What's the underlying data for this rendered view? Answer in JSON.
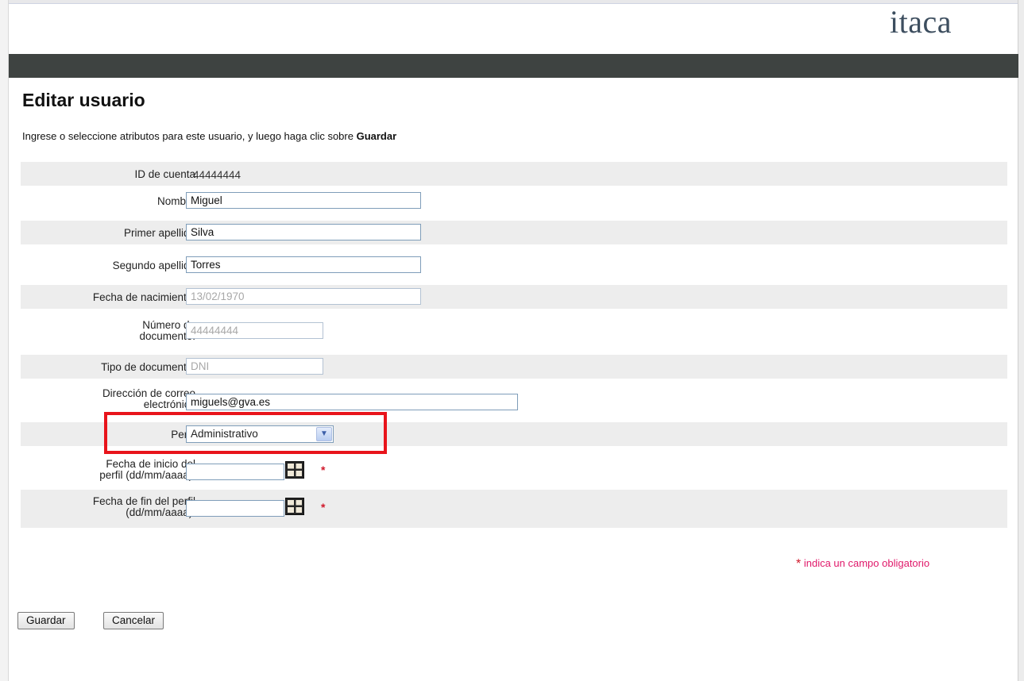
{
  "header": {
    "logo_text": "itaca"
  },
  "page": {
    "title": "Editar usuario",
    "instruction_prefix": "Ingrese o seleccione atributos para este usuario, y luego haga clic sobre ",
    "instruction_bold": "Guardar"
  },
  "form": {
    "account_id": {
      "label": "ID de cuenta",
      "value": "44444444"
    },
    "first_name": {
      "label": "Nombre",
      "value": "Miguel"
    },
    "last_name_1": {
      "label": "Primer apellido",
      "value": "Silva"
    },
    "last_name_2": {
      "label": "Segundo apellido",
      "value": "Torres"
    },
    "birth_date": {
      "label": "Fecha de nacimiento:",
      "value": "13/02/1970"
    },
    "doc_number": {
      "label_line1": "Número de",
      "label_line2": "documento:",
      "value": "44444444"
    },
    "doc_type": {
      "label": "Tipo de documento:",
      "value": "DNI"
    },
    "email": {
      "label_line1": "Dirección de correo",
      "label_line2": "electrónico",
      "value": "miguels@gva.es"
    },
    "profile": {
      "label": "Perfil",
      "selected": "Administrativo"
    },
    "profile_start": {
      "label_line1": "Fecha de inicio del",
      "label_line2": "perfil (dd/mm/aaaa):",
      "value": "",
      "required_mark": "*"
    },
    "profile_end": {
      "label_line1": "Fecha de fin del perfil",
      "label_line2": "(dd/mm/aaaa):",
      "value": "",
      "required_mark": "*"
    }
  },
  "required_note": {
    "star": "*",
    "text": " indica un campo obligatorio"
  },
  "buttons": {
    "save": "Guardar",
    "cancel": "Cancelar"
  },
  "colors": {
    "header_bar": "#3e4341",
    "highlight": "#e8141b",
    "required": "#d0182a",
    "note_text": "#e0196a"
  }
}
